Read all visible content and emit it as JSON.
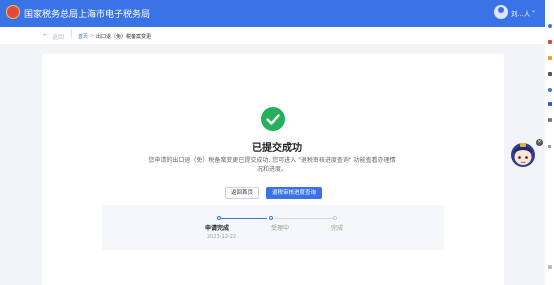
{
  "header": {
    "site_title": "国家税务总局上海市电子税务局",
    "user_name": "刘...人",
    "user_caret": "⌄"
  },
  "breadcrumb": {
    "back_label": "返回",
    "home_label": "首页",
    "separator": ">",
    "current_label": "出口退（免）税备案变更"
  },
  "result": {
    "title": "已提交成功",
    "description": "您申请的出口退（免）税备案变更已提交成功, 您可进入 \"退税审核进度查询\" 功能查看办理情况和进度。",
    "home_button": "返回首页",
    "progress_button": "退税审核进度查询"
  },
  "steps": [
    {
      "label": "申请完成",
      "date": "2023-12-22",
      "state": "done"
    },
    {
      "label": "受理中",
      "date": "",
      "state": "pending"
    },
    {
      "label": "完成",
      "date": "",
      "state": "pending"
    }
  ],
  "colors": {
    "brand": "#3a73e8",
    "success": "#25b15c"
  }
}
